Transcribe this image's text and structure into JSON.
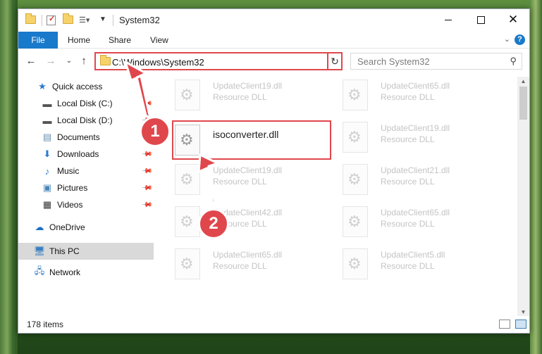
{
  "window": {
    "title": "System32"
  },
  "ribbon": {
    "tabs": [
      "File",
      "Home",
      "Share",
      "View"
    ],
    "help": "?"
  },
  "address": {
    "path": "C:\\Windows\\System32"
  },
  "search": {
    "placeholder": "Search System32"
  },
  "sidebar": {
    "quick_access": "Quick access",
    "items": [
      "Local Disk (C:)",
      "Local Disk (D:)",
      "Documents",
      "Downloads",
      "Music",
      "Pictures",
      "Videos"
    ],
    "onedrive": "OneDrive",
    "thispc": "This PC",
    "network": "Network"
  },
  "files": [
    {
      "name": "UpdateClient19.dll",
      "type": "Resource DLL"
    },
    {
      "name": "UpdateClient65.dll",
      "type": "Resource DLL"
    },
    {
      "name": "isoconverter.dll",
      "type": ""
    },
    {
      "name": "UpdateClient19.dll",
      "type": "Resource DLL"
    },
    {
      "name": "UpdateClient19.dll",
      "type": "Resource DLL"
    },
    {
      "name": "UpdateClient21.dll",
      "type": "Resource DLL"
    },
    {
      "name": "UpdateClient42.dll",
      "type": "Resource DLL"
    },
    {
      "name": "UpdateClient65.dll",
      "type": "Resource DLL"
    },
    {
      "name": "UpdateClient65.dll",
      "type": "Resource DLL"
    },
    {
      "name": "UpdateClient5.dll",
      "type": "Resource DLL"
    }
  ],
  "status": {
    "count": "178 items"
  },
  "annotations": {
    "step1": "1",
    "step2": "2",
    "color": "#e0474c"
  }
}
